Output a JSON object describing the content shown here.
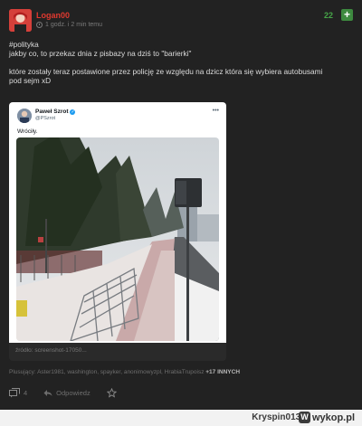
{
  "post": {
    "author": "Logan00",
    "time": "1 godz. i 2 min temu",
    "votes": "22",
    "plus_symbol": "+",
    "lines": [
      "#polityka",
      "jakby co, to przekaz dnia z pisbazy na dziś to \"barierki\"",
      "które zostały teraz postawione przez policję ze względu na dzicz która się wybiera autobusami",
      "pod sejm xD"
    ]
  },
  "tweet": {
    "name": "Paweł Szrot",
    "verified_glyph": "✓",
    "handle": "@PSzrot",
    "menu": "•••",
    "text": "Wróciły."
  },
  "source": "źródło: screenshot-17050...",
  "pluses": {
    "prefix": "Plusujący: Aster1981, washington, spayker, anonimowyzpl, HrabiaTrupoisz",
    "more": "+17 INNYCH"
  },
  "actions": {
    "comments_count": "4",
    "reply_label": "Odpowiedz"
  },
  "footer": {
    "user": "Kryspin013",
    "via": "z",
    "site": "wykop.pl",
    "badge": "W"
  },
  "colors": {
    "accent_green": "#46a548",
    "author_red": "#e0392f",
    "background": "#222222"
  }
}
